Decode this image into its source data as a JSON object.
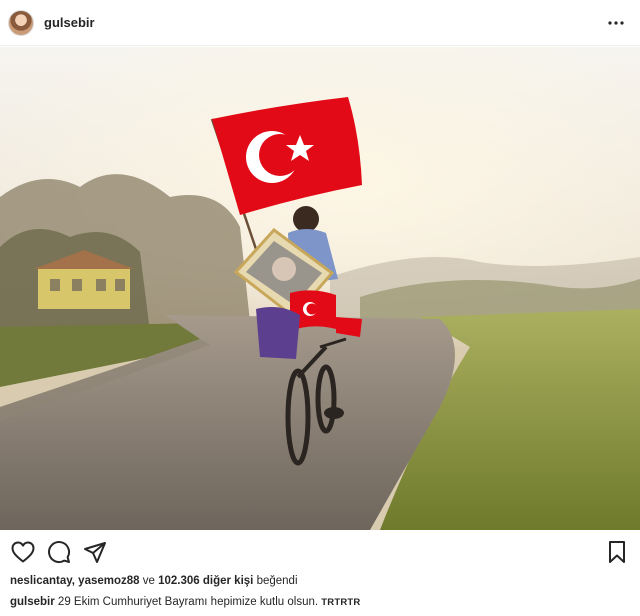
{
  "post": {
    "author": "gulsebir",
    "more_icon": "more-horizontal-icon"
  },
  "photo": {
    "description_icons": [
      "turkish-flag",
      "portrait-frame",
      "bicycle",
      "road"
    ],
    "colors": {
      "flag_red": "#e30a17",
      "sky": "#f2ede2",
      "grass": "#8f9a45"
    }
  },
  "actions": {
    "like_icon": "heart-icon",
    "comment_icon": "comment-icon",
    "share_icon": "paper-plane-icon",
    "save_icon": "bookmark-icon"
  },
  "likes": {
    "users": "neslicantay, yasemoz88",
    "connector": " ve ",
    "count_text": "102.306 diğer kişi",
    "suffix": " beğendi"
  },
  "caption": {
    "author": "gulsebir",
    "text": " 29 Ekim Cumhuriyet Bayramı hepimize kutlu olsun. ",
    "tags": "TRTRTR"
  }
}
